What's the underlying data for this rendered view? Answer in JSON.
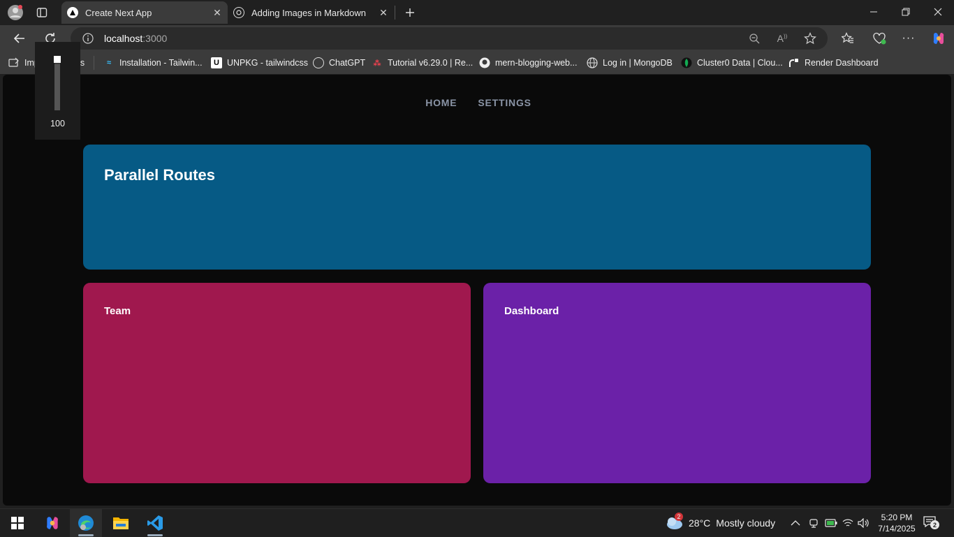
{
  "browser": {
    "tabs": [
      {
        "title": "Create Next App",
        "active": true
      },
      {
        "title": "Adding Images in Markdown",
        "active": false
      }
    ],
    "address": {
      "host": "localhost",
      "port": ":3000"
    },
    "bookmarks": [
      {
        "label": "Import favorites"
      },
      {
        "label": "Installation - Tailwin..."
      },
      {
        "label": "UNPKG - tailwindcss"
      },
      {
        "label": "ChatGPT"
      },
      {
        "label": "Tutorial v6.29.0 | Re..."
      },
      {
        "label": "mern-blogging-web..."
      },
      {
        "label": "Log in | MongoDB"
      },
      {
        "label": "Cluster0 Data | Clou..."
      },
      {
        "label": "Render Dashboard"
      }
    ]
  },
  "zoom": {
    "value": "100",
    "level_percent": 100
  },
  "page": {
    "nav": {
      "home": "HOME",
      "settings": "SETTINGS"
    },
    "hero": {
      "title": "Parallel Routes",
      "color": "#065a85"
    },
    "team": {
      "title": "Team",
      "color": "#a0184e"
    },
    "dashboard": {
      "title": "Dashboard",
      "color": "#6b21a8"
    }
  },
  "taskbar": {
    "weather": {
      "temp": "28°C",
      "condition": "Mostly cloudy",
      "badge": "2"
    },
    "clock": {
      "time": "5:20 PM",
      "date": "7/14/2025"
    },
    "notifications": "2"
  },
  "icons": [
    "profile-icon",
    "tab-actions-icon",
    "nextjs-favicon-icon",
    "chatgpt-favicon-icon",
    "back-icon",
    "refresh-icon",
    "info-icon",
    "zoom-out-icon",
    "read-aloud-icon",
    "favorite-star-icon",
    "favorites-icon",
    "browser-essentials-icon",
    "more-icon",
    "copilot-icon",
    "windows-start-icon",
    "edge-icon",
    "file-explorer-icon",
    "vscode-icon",
    "weather-icon",
    "chevron-up-icon",
    "meet-now-icon",
    "battery-icon",
    "wifi-icon",
    "volume-icon",
    "notification-icon"
  ]
}
